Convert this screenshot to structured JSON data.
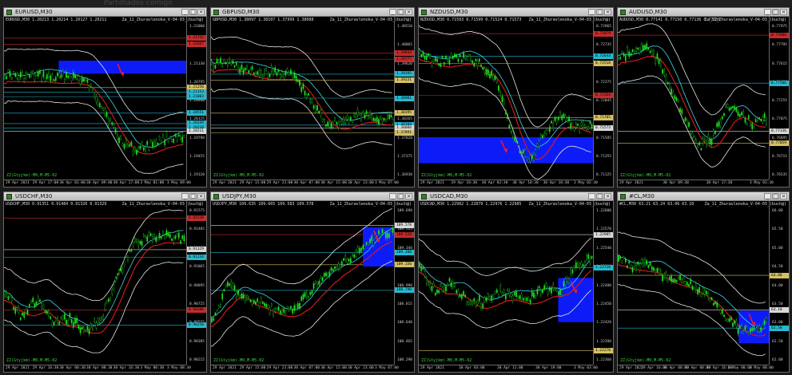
{
  "topbar": {
    "text": "Partilhados comigo"
  },
  "colors": {
    "candle": "#20e020",
    "redline": "#e01a1a",
    "whiteline": "#e6e6e6",
    "cyanline": "#43d6e6",
    "level_yellow": "#d4c060",
    "level_cyan": "#24b9cf",
    "level_red": "#c82a2a",
    "box_blue": "#0d1cf7",
    "arrow_red": "#ff1a1a"
  },
  "windows": [
    {
      "title": "EURUSD,M30",
      "info": "EURUSD,M30 1.20213 1.20214 1.20127 1.20211",
      "ea": "Za_11_Zhuravlenoka_V-04-03_(buch@)",
      "indicator": "ZZ(Gtyjkm)-M0,M-M5-02",
      "price_ticks": [
        "1.21800",
        "1.21465",
        "1.21130",
        "1.20795",
        "1.20460",
        "1.20125",
        "1.19790",
        "1.19455",
        "1.19120"
      ],
      "time_ticks": [
        "29 Apr 2021",
        "29 Apr 17:00",
        "30 Apr 01:00",
        "30 Apr 09:00",
        "30 Apr 17:00",
        "3 May 01:00",
        "3 May 09:00"
      ],
      "price_labels": [
        {
          "text": "1.21742",
          "color": "red"
        },
        {
          "text": "1.21667",
          "color": "red"
        },
        {
          "text": "1.21250",
          "color": "yellow"
        },
        {
          "text": "1.21153",
          "color": "cyan"
        },
        {
          "text": "1.21083",
          "color": "cyan"
        },
        {
          "text": "1.20551",
          "color": "cyan"
        },
        {
          "text": "1.20349",
          "color": "cyan"
        },
        {
          "text": "1.20238",
          "color": "cyan"
        },
        {
          "text": "1.20211",
          "color": "white"
        }
      ],
      "box": true
    },
    {
      "title": "GBPUSD,M30",
      "info": "GBPUSD,M30 1.38097 1.38107 1.37999 1.38088",
      "ea": "Za_11_Zhuravlenoka_V-04-03_(buch@)",
      "indicator": "ZZ(Gtyjkm)-M0,M-M5-02",
      "price_ticks": [
        "1.40510",
        "1.40065",
        "1.39620",
        "1.39155",
        "1.38710",
        "1.38265",
        "1.37820",
        "1.37375",
        "1.36930"
      ],
      "time_ticks": [
        "29 Apr 2021",
        "29 Apr 15:00",
        "29 Apr 23:00",
        "30 Apr 07:00",
        "30 Apr 15:00",
        "30 Apr 23:00",
        "3 May 07:00"
      ],
      "price_labels": [
        {
          "text": "1.39944",
          "color": "red"
        },
        {
          "text": "1.39777",
          "color": "red"
        },
        {
          "text": "1.39395",
          "color": "cyan"
        },
        {
          "text": "1.39231",
          "color": "yellow"
        },
        {
          "text": "1.38901",
          "color": "cyan"
        },
        {
          "text": "1.38395",
          "color": "yellow"
        },
        {
          "text": "1.38104",
          "color": "cyan"
        },
        {
          "text": "1.38088",
          "color": "white"
        },
        {
          "text": "1.37891",
          "color": "yellow"
        }
      ],
      "box": false
    },
    {
      "title": "NZDUSD,M30",
      "info": "NZDUSD,M30 0.71593 0.71599 0.71524 0.71573",
      "ea": "Za_11_Zhuravlenoka_V-04-03_(buch@)",
      "indicator": "ZZ(Gtyjkm)-M0,M-M5-02",
      "price_ticks": [
        "0.72965",
        "0.72735",
        "0.72505",
        "0.72275",
        "0.72045",
        "0.71815",
        "0.71585",
        "0.71355",
        "0.71125"
      ],
      "time_ticks": [
        "29 Apr 2021",
        "29 Apr 18:30",
        "30 Apr 02:30",
        "30 Apr 10:30",
        "30 Apr 18:30",
        "3 May 02:30"
      ],
      "price_labels": [
        {
          "text": "0.72879",
          "color": "red"
        },
        {
          "text": "0.72643",
          "color": "cyan"
        },
        {
          "text": "0.72518",
          "color": "yellow"
        },
        {
          "text": "0.72164",
          "color": "red"
        },
        {
          "text": "0.71705",
          "color": "yellow"
        },
        {
          "text": "0.71573",
          "color": "white"
        }
      ],
      "box": true
    },
    {
      "title": "AUDUSD,M30",
      "info": "AUDUSD,M30 0.77141 0.77150 0.77136 0.77136",
      "ea": "Za_11_Zhuravlenoka_V-04-03_(buch@)",
      "indicator": "ZZ(Gtyjkm)-M0,M-M5-02",
      "price_ticks": [
        "0.77975",
        "0.77795",
        "0.77615",
        "0.77435",
        "0.77255",
        "0.77075",
        "0.76895",
        "0.76715",
        "0.76535"
      ],
      "time_ticks": [
        "29 Apr 2021",
        "30 Apr 09:30",
        "30 Apr 17:30",
        "3 May 01:30"
      ],
      "price_labels": [
        {
          "text": "0.77880",
          "color": "red"
        },
        {
          "text": "0.77506",
          "color": "cyan"
        },
        {
          "text": "0.77136",
          "color": "white"
        },
        {
          "text": "0.77059",
          "color": "yellow"
        }
      ],
      "box": false
    },
    {
      "title": "USDCHF,M30",
      "info": "USDCHF,M30 0.91351 0.91484 0.91326 0.91329",
      "ea": "Za_11_Zhuravlenoka_V-04-03_(buch@)",
      "indicator": "ZZ(Gtyjkm)-M0,M-M5-02",
      "price_ticks": [
        "0.91575",
        "0.91405",
        "0.91235",
        "0.91065",
        "0.90895",
        "0.90725",
        "0.90555",
        "0.90385",
        "0.90215"
      ],
      "time_ticks": [
        "29 Apr 2021",
        "29 Apr 16:30",
        "30 Apr 00:30",
        "30 Apr 08:30",
        "30 Apr 16:30",
        "3 May 00:30",
        "3 May 08:30"
      ],
      "price_labels": [
        {
          "text": "0.91538",
          "color": "red"
        },
        {
          "text": "0.91329",
          "color": "white"
        },
        {
          "text": "0.91234",
          "color": "cyan"
        },
        {
          "text": "0.90380",
          "color": "red"
        },
        {
          "text": "0.90250",
          "color": "cyan"
        }
      ],
      "box": false
    },
    {
      "title": "USDJPY,M30",
      "info": "USDJPY,M30 109.635 109.665 109.583 109.578",
      "ea": "Za_11_Zhuravlenoka_V-04-03_(buch@)",
      "indicator": "ZZ(Gtyjkm)-M0,M-M5-02",
      "price_ticks": [
        "109.690",
        "109.515",
        "109.340",
        "109.165",
        "108.990",
        "108.815",
        "108.640",
        "108.465",
        "108.290"
      ],
      "time_ticks": [
        "29 Apr 2021",
        "29 Apr 15:00",
        "29 Apr 23:00",
        "30 Apr 07:00",
        "30 Apr 15:00",
        "30 Apr 23:00",
        "3 May 07:00"
      ],
      "price_labels": [
        {
          "text": "109.578",
          "color": "white"
        },
        {
          "text": "109.520",
          "color": "red"
        },
        {
          "text": "109.280",
          "color": "cyan"
        },
        {
          "text": "109.150",
          "color": "yellow"
        },
        {
          "text": "108.790",
          "color": "cyan"
        }
      ],
      "box": true
    },
    {
      "title": "USDCAD,M30",
      "info": "USDCAD,M30 1.22982 1.22879 1.22976 1.22985",
      "ea": "Za_11_Zhuravlenoka_V-04-03_(buch@)",
      "indicator": "ZZ(Gtyjkm)-M0,M-M5-02",
      "price_ticks": [
        "1.22600",
        "1.22570",
        "1.22540",
        "1.22510",
        "1.22480",
        "1.22450",
        "1.22420",
        "1.22390",
        "1.22360"
      ],
      "time_ticks": [
        "29 Apr 2021",
        "30 Apr 03:00",
        "30 Apr 11:00",
        "30 Apr 19:00",
        "3 May 03:00"
      ],
      "price_labels": [
        {
          "text": "1.22985",
          "color": "white"
        },
        {
          "text": "1.22720",
          "color": "cyan"
        },
        {
          "text": "1.22270",
          "color": "yellow"
        }
      ],
      "box": true
    },
    {
      "title": "#CL,M30",
      "info": "#CL,M30 63.21 63.24 63.06 63.10",
      "ea": "Za_11_Zhuravlenoka_V-04-03_(buch@)",
      "indicator": "ZZ(Gtyjkm)-M0,M-M5-02",
      "price_ticks": [
        "66.00",
        "65.50",
        "65.00",
        "64.50",
        "64.00",
        "63.50",
        "63.00",
        "62.50",
        "62.00"
      ],
      "time_ticks": [
        "29 Apr 2021",
        "29 Apr 16:00",
        "30 Apr 00:00",
        "30 Apr 08:00",
        "30 Apr 16:00",
        "3 May 00:00",
        "3 May 08:00"
      ],
      "price_labels": [
        {
          "text": "64.80",
          "color": "yellow"
        },
        {
          "text": "63.10",
          "color": "white"
        },
        {
          "text": "62.50",
          "color": "cyan"
        }
      ],
      "box": true
    }
  ]
}
